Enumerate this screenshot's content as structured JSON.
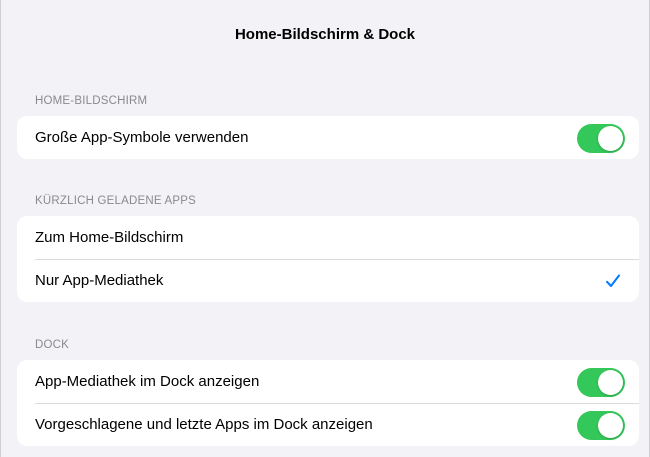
{
  "header": {
    "title": "Home-Bildschirm & Dock"
  },
  "sections": [
    {
      "header": "HOME-BILDSCHIRM",
      "rows": [
        {
          "label": "Große App-Symbole verwenden",
          "control": "toggle",
          "on": true
        }
      ]
    },
    {
      "header": "KÜRZLICH GELADENE APPS",
      "rows": [
        {
          "label": "Zum Home-Bildschirm",
          "control": "none",
          "selected": false
        },
        {
          "label": "Nur App-Mediathek",
          "control": "checkmark",
          "selected": true
        }
      ]
    },
    {
      "header": "DOCK",
      "rows": [
        {
          "label": "App-Mediathek im Dock anzeigen",
          "control": "toggle",
          "on": true
        },
        {
          "label": "Vorgeschlagene und letzte Apps im Dock anzeigen",
          "control": "toggle",
          "on": true
        }
      ]
    }
  ],
  "colors": {
    "toggle_on": "#34c759",
    "accent": "#007aff",
    "background": "#f2f2f7",
    "section_header": "#8a8a8e"
  },
  "icons": {
    "checkmark": "checkmark-icon"
  }
}
